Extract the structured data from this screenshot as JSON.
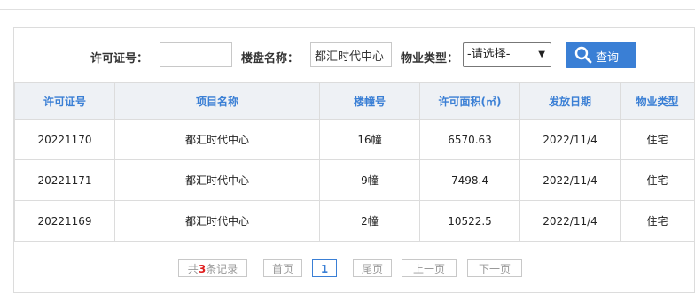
{
  "search": {
    "permit_label": "许可证号：",
    "permit_value": "",
    "building_label": "楼盘名称：",
    "building_value": "都汇时代中心",
    "type_label": "物业类型：",
    "type_selected": "-请选择-",
    "search_button": "查询"
  },
  "table": {
    "headers": [
      "许可证号",
      "项目名称",
      "楼幢号",
      "许可面积(㎡)",
      "发放日期",
      "物业类型"
    ],
    "rows": [
      [
        "20221170",
        "都汇时代中心",
        "16幢",
        "6570.63",
        "2022/11/4",
        "住宅"
      ],
      [
        "20221171",
        "都汇时代中心",
        "9幢",
        "7498.4",
        "2022/11/4",
        "住宅"
      ],
      [
        "20221169",
        "都汇时代中心",
        "2幢",
        "10522.5",
        "2022/11/4",
        "住宅"
      ]
    ]
  },
  "pager": {
    "total_prefix": "共",
    "total_count": "3",
    "total_suffix": "条记录",
    "first": "首页",
    "current": "1",
    "last": "尾页",
    "prev": "上一页",
    "next": "下一页"
  }
}
